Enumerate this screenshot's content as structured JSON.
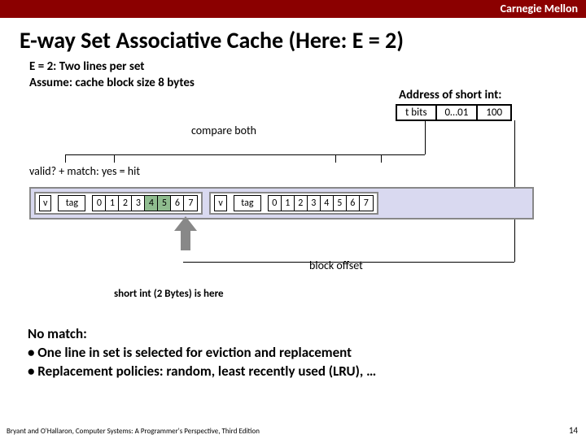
{
  "header": {
    "brand": "Carnegie Mellon"
  },
  "title": "E-way Set Associative Cache (Here: E = 2)",
  "subtitle": {
    "l1": "E = 2: Two lines per set",
    "l2": "Assume: cache block size 8 bytes"
  },
  "address": {
    "label": "Address of short int:",
    "fields": {
      "tbits": "t bits",
      "set": "0…01",
      "off": "100"
    }
  },
  "labels": {
    "compare": "compare both",
    "valid_match": "valid?  +  match: yes = hit",
    "block_offset": "block offset",
    "short_int": "short int (2 Bytes) is here"
  },
  "cache": {
    "v": "v",
    "tag": "tag",
    "bytes": [
      "0",
      "1",
      "2",
      "3",
      "4",
      "5",
      "6",
      "7"
    ],
    "hit_indices": [
      4,
      5
    ]
  },
  "nomatch": {
    "h": "No match:",
    "b1": "• One line in set is selected for eviction and replacement",
    "b2": "• Replacement policies: random, least recently used (LRU), …"
  },
  "footer": "Bryant and O'Hallaron, Computer Systems: A Programmer's Perspective, Third Edition",
  "page": "14"
}
